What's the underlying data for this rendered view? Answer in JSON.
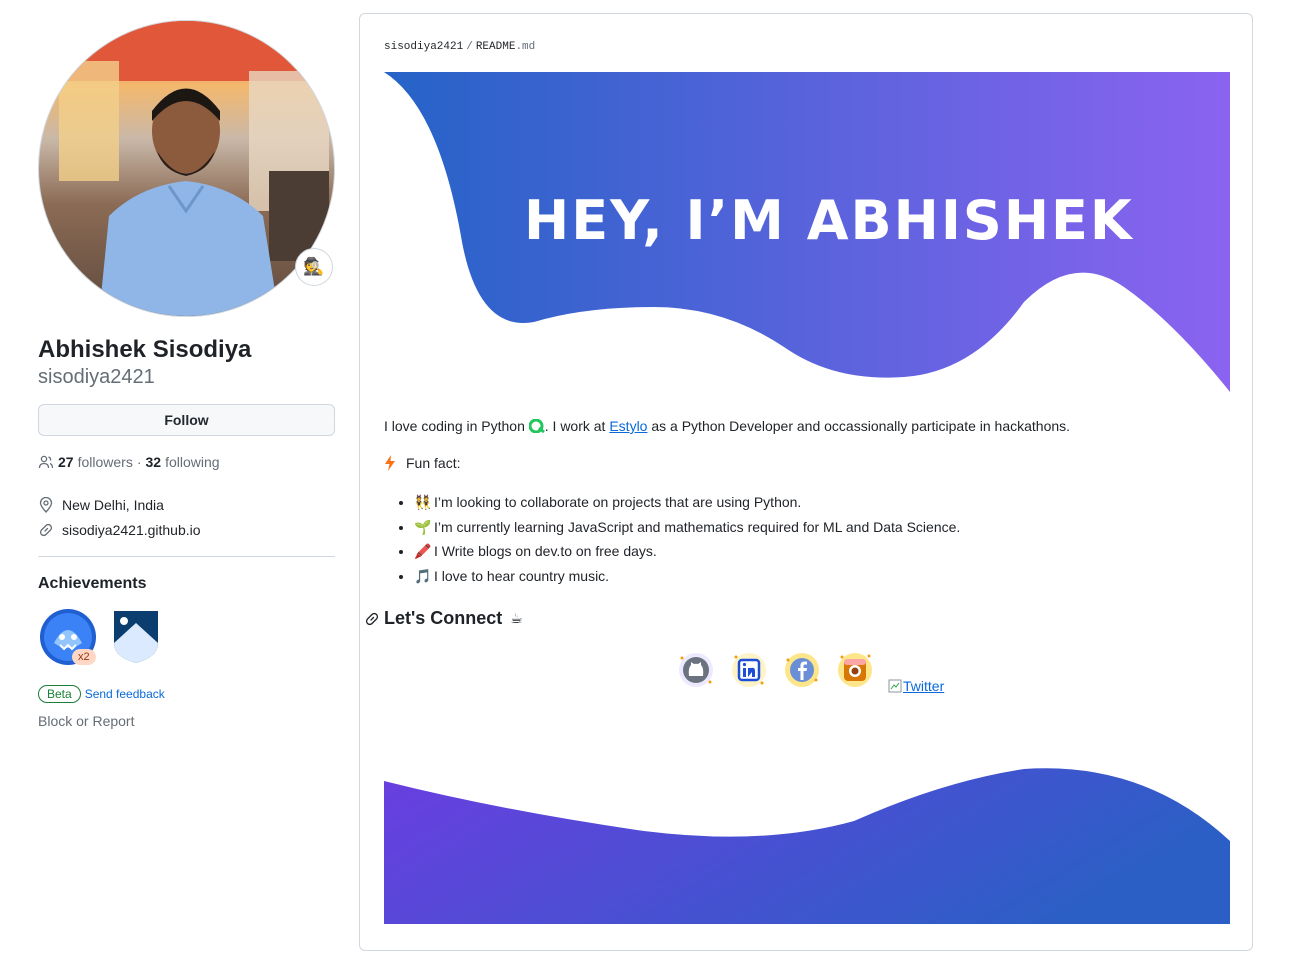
{
  "profile": {
    "fullname": "Abhishek Sisodiya",
    "login": "sisodiya2421",
    "status_emoji": "🕵️",
    "follow_label": "Follow",
    "followers_count": "27",
    "followers_label": "followers",
    "following_sep": "·",
    "following_count": "32",
    "following_label": "following",
    "location": "New Delhi, India",
    "website": "sisodiya2421.github.io",
    "achievements_title": "Achievements",
    "achievement_count": "x2",
    "beta_label": "Beta",
    "feedback_label": "Send feedback",
    "block_label": "Block or Report"
  },
  "readme": {
    "breadcrumb_user": "sisodiya2421",
    "breadcrumb_sep": "/",
    "breadcrumb_file": "README",
    "breadcrumb_ext": ".md",
    "hero_text": "HEY, I’M ABHISHEK",
    "intro_prefix": "I love coding in Python ",
    "intro_mid": ". I work at ",
    "intro_link": "Estylo",
    "intro_suffix": " as a Python Developer and occassionally participate in hackathons.",
    "funfact_label": "Fun fact:",
    "facts": [
      {
        "emoji": "👯",
        "text": "I’m looking to collaborate on projects that are using Python."
      },
      {
        "emoji": "🌱",
        "text": "I’m currently learning JavaScript and mathematics required for ML and Data Science."
      },
      {
        "emoji": "🖍️",
        "text": "I Write blogs on dev.to on free days."
      },
      {
        "emoji": "🎵",
        "text": "I love to hear country music."
      }
    ],
    "connect_title": "Let's Connect",
    "connect_emoji": "☕",
    "twitter_label": "Twitter",
    "colors": {
      "gradient_start": "#2563c7",
      "gradient_end": "#8b63f0",
      "footer_start": "#6a3ee0",
      "footer_end": "#2c5fc6"
    }
  }
}
